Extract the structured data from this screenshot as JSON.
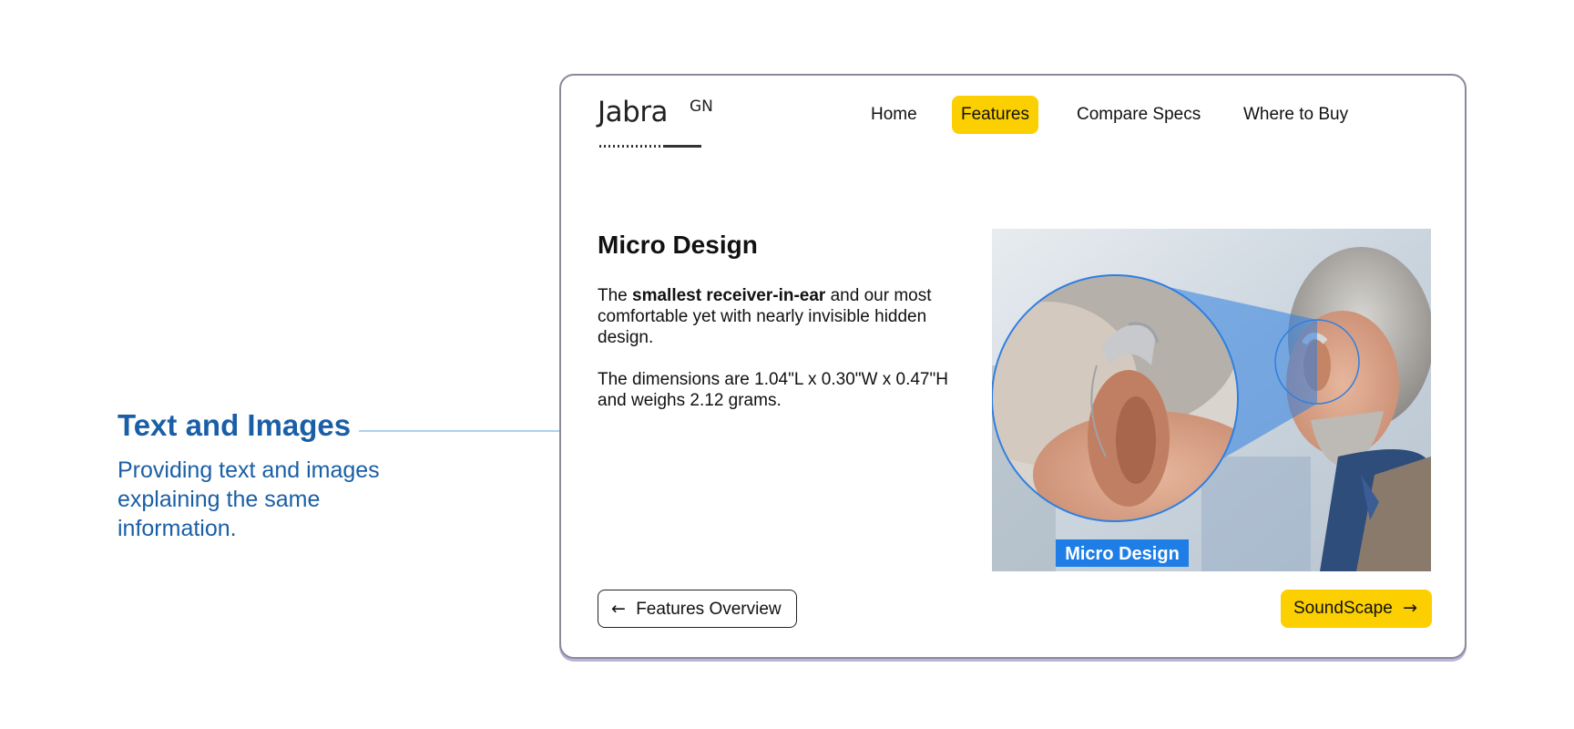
{
  "annotation": {
    "title": "Text and Images",
    "description": "Providing text and images explaining the same information."
  },
  "brand": {
    "name": "Jabra",
    "suffix": "GN"
  },
  "nav": {
    "items": [
      {
        "label": "Home",
        "active": false
      },
      {
        "label": "Features",
        "active": true
      },
      {
        "label": "Compare Specs",
        "active": false
      },
      {
        "label": "Where to Buy",
        "active": false
      }
    ]
  },
  "content": {
    "title": "Micro Design",
    "para1_prefix": "The ",
    "para1_bold": "smallest receiver-in-ear",
    "para1_suffix": " and our most comfortable yet with nearly invisible hidden design.",
    "para2": "The dimensions are 1.04\"L x 0.30\"W x 0.47\"H and weighs 2.12 grams.",
    "image_label": "Micro Design"
  },
  "buttons": {
    "back_label": "Features Overview",
    "next_label": "SoundScape"
  },
  "colors": {
    "accent": "#fccf00",
    "annotation": "#1a5fa6",
    "image_badge": "#1e7ee6"
  }
}
